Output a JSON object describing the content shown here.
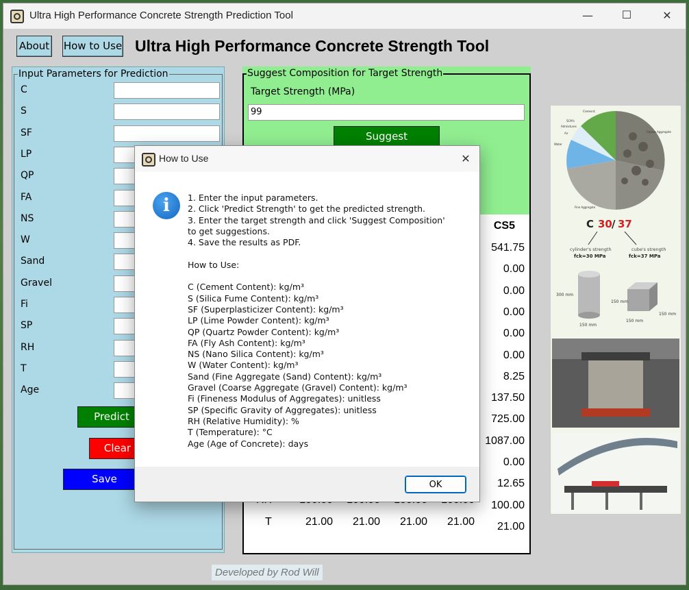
{
  "window": {
    "title": "Ultra High Performance Concrete Strength Prediction Tool",
    "minimize": "—",
    "maximize": "☐",
    "close": "✕"
  },
  "toolbar": {
    "about_label": "About",
    "howto_label": "How to Use",
    "app_title": "Ultra High Performance Concrete Strength Tool"
  },
  "input_panel": {
    "legend": "Input Parameters for Prediction",
    "fields": [
      "C",
      "S",
      "SF",
      "LP",
      "QP",
      "FA",
      "NS",
      "W",
      "Sand",
      "Gravel",
      "Fi",
      "SP",
      "RH",
      "T",
      "Age"
    ],
    "predict_label": "Predict Strength",
    "clear_label": "Clear Inputs",
    "save_label": "Save Predictions"
  },
  "suggest_panel": {
    "legend": "Suggest Composition for Target Strength",
    "target_label": "Target Strength (MPa)",
    "target_value": "99",
    "suggest_label": "Suggest Composition"
  },
  "results": {
    "header_last": "CS5",
    "last_col": [
      "541.75",
      "0.00",
      "0.00",
      "0.00",
      "0.00",
      "0.00",
      "8.25",
      "137.50",
      "725.00",
      "1087.00",
      "0.00",
      "12.65",
      "100.00",
      "21.00"
    ],
    "rh_row": {
      "label": "RH",
      "values": [
        "100.00",
        "100.00",
        "100.00",
        "100.00"
      ]
    },
    "t_row": {
      "label": "T",
      "values": [
        "21.00",
        "21.00",
        "21.00",
        "21.00"
      ]
    }
  },
  "dialog": {
    "title": "How to Use",
    "close": "✕",
    "info_glyph": "i",
    "body": "1. Enter the input parameters.\n2. Click 'Predict Strength' to get the predicted strength.\n3. Enter the target strength and click 'Suggest Composition'\nto get suggestions.\n4. Save the results as PDF.\n\nHow to Use:\n\nC (Cement Content): kg/m³\nS (Silica Fume Content): kg/m³\nSF (Superplasticizer Content): kg/m³\nLP (Lime Powder Content): kg/m³\nQP (Quartz Powder Content): kg/m³\nFA (Fly Ash Content): kg/m³\nNS (Nano Silica Content): kg/m³\nW (Water Content): kg/m³\nSand (Fine Aggregate (Sand) Content): kg/m³\nGravel (Coarse Aggregate (Gravel) Content): kg/m³\nFi (Fineness Modulus of Aggregates): unitless\nSP (Specific Gravity of Aggregates): unitless\nRH (Relative Humidity): %\nT (Temperature): °C\nAge (Age of Concrete): days",
    "ok_label": "OK"
  },
  "side_images": {
    "pie_labels": {
      "cement": "Cement",
      "coarse": "Coarse Aggregate",
      "water": "Water",
      "fine": "Fine Aggregate",
      "scms": "SCM's",
      "admixtures": "Admixtures",
      "air": "Air"
    },
    "strength_prefix": "C",
    "strength_cyl": "30",
    "strength_sep": "/",
    "strength_cube": "37",
    "cyl_caption": "cylinder's strength",
    "cube_caption": "cube's strength",
    "fck_cyl": "fck=30 MPa",
    "fck_cube": "fck=37 MPa",
    "dim_300": "300 mm",
    "dim_150a": "150 mm",
    "dim_150b": "150 mm",
    "dim_150c": "150 mm",
    "dim_150d": "150 mm"
  },
  "footer": {
    "credit": "Developed by Rod Will"
  },
  "colors": {
    "panel_blue": "#add8e6",
    "panel_green": "#90ee90",
    "btn_green": "#008000",
    "btn_red": "#ff0000",
    "btn_blue": "#0000ff",
    "window_bg": "#d0d0d0"
  }
}
